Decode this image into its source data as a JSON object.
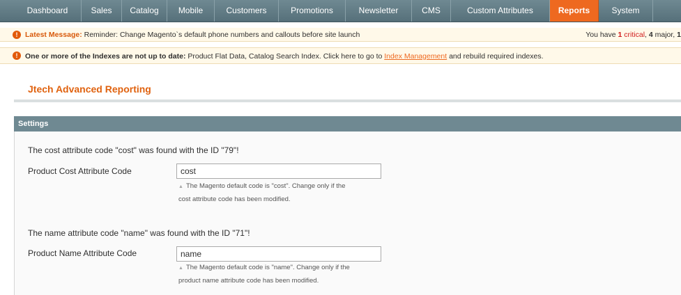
{
  "nav": {
    "items": [
      {
        "label": "Dashboard"
      },
      {
        "label": "Sales"
      },
      {
        "label": "Catalog"
      },
      {
        "label": "Mobile"
      },
      {
        "label": "Customers"
      },
      {
        "label": "Promotions"
      },
      {
        "label": "Newsletter"
      },
      {
        "label": "CMS"
      },
      {
        "label": "Custom Attributes"
      },
      {
        "label": "Reports"
      },
      {
        "label": "System"
      }
    ],
    "active": "Reports"
  },
  "messages": {
    "latest": {
      "label": "Latest Message:",
      "text": " Reminder: Change Magento`s default phone numbers and callouts before site launch",
      "right_prefix": "You have ",
      "critical_count": "1",
      "critical_label": " critical",
      "separator": ", ",
      "major_count": "4",
      "major_label": " major, ",
      "trailing": "1"
    },
    "index": {
      "bold_text": "One or more of the Indexes are not up to date:",
      "text": " Product Flat Data, Catalog Search Index. Click here to go to ",
      "link_label": "Index Management",
      "suffix": " and rebuild required indexes."
    }
  },
  "page": {
    "title": "Jtech Advanced Reporting"
  },
  "settings": {
    "header": "Settings",
    "cost": {
      "found_text": "The cost attribute code \"cost\" was found with the ID \"79\"!",
      "label": "Product Cost Attribute Code",
      "value": "cost",
      "note_line1": "The Magento default code is \"cost\". Change only if the",
      "note_line2": "cost attribute code has been modified."
    },
    "name": {
      "found_text": "The name attribute code \"name\" was found with the ID \"71\"!",
      "label": "Product Name Attribute Code",
      "value": "name",
      "note_line1": "The Magento default code is \"name\". Change only if the",
      "note_line2": "product name attribute code has been modified."
    }
  }
}
